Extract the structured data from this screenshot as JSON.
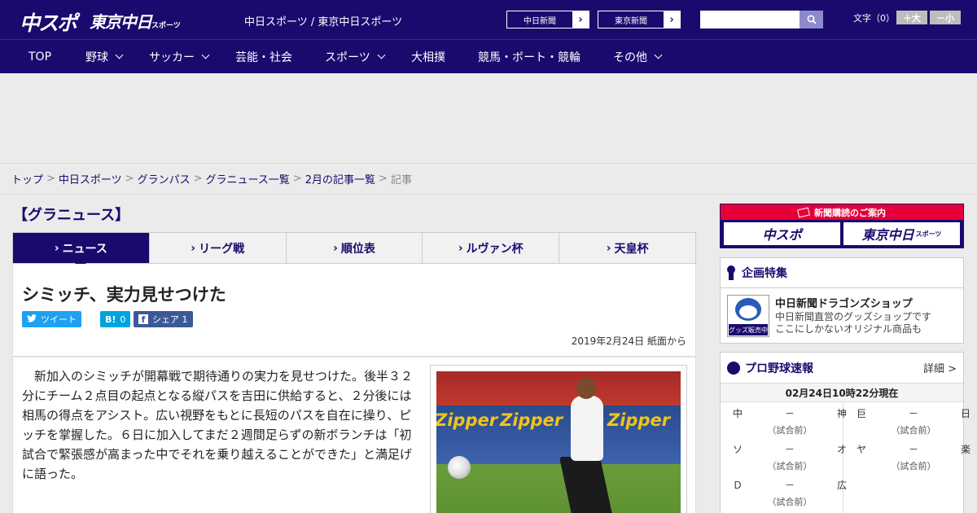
{
  "header": {
    "logo_main": "中スポ",
    "logo_tokyo": "東京中日",
    "logo_tokyo_small": "スポーツ",
    "site_title": "中日スポーツ / 東京中日スポーツ",
    "paper_links": [
      {
        "label": "中日新聞",
        "arrow": "›"
      },
      {
        "label": "東京新聞",
        "arrow": "›"
      }
    ],
    "search": {
      "placeholder": "",
      "value": ""
    },
    "font_size_label": "文字（0）",
    "font_larger": "＋大",
    "font_smaller": "－小"
  },
  "nav": {
    "items": [
      {
        "label": "TOP",
        "dropdown": false
      },
      {
        "label": "野球",
        "dropdown": true
      },
      {
        "label": "サッカー",
        "dropdown": true
      },
      {
        "label": "芸能・社会",
        "dropdown": false
      },
      {
        "label": "スポーツ",
        "dropdown": true
      },
      {
        "label": "大相撲",
        "dropdown": false
      },
      {
        "label": "競馬・ボート・競輪",
        "dropdown": false
      },
      {
        "label": "その他",
        "dropdown": true
      }
    ]
  },
  "breadcrumb": {
    "items": [
      "トップ",
      "中日スポーツ",
      "グランパス",
      "グラニュース一覧",
      "2月の記事一覧"
    ],
    "current": "記事",
    "separator": ">"
  },
  "section": {
    "title": "【グラニュース】"
  },
  "tabs": [
    {
      "label": "ニュース",
      "active": true
    },
    {
      "label": "リーグ戦",
      "active": false
    },
    {
      "label": "順位表",
      "active": false
    },
    {
      "label": "ルヴァン杯",
      "active": false
    },
    {
      "label": "天皇杯",
      "active": false
    }
  ],
  "article": {
    "headline": "シミッチ、実力見せつけた",
    "share": {
      "tweet_label": "ツイート",
      "hatena_icon": "B!",
      "hatena_count": "0",
      "facebook_label": "シェア",
      "facebook_count": "1"
    },
    "date": "2019年2月24日 紙面から",
    "body": "新加入のシミッチが開幕戦で期待通りの実力を見せつけた。後半３２分にチーム２点目の起点となる縦パスを吉田に供給すると、２分後には相馬の得点をアシスト。広い視野をもとに長短のパスを自在に操り、ピッチを掌握した。６日に加入してまだ２週間足らずの新ボランチは「初試合で緊張感が高まった中でそれを乗り越えることができた」と満足げに語った。",
    "photo_ad_text": "Zipper"
  },
  "sidebar": {
    "subscribe": {
      "title": "新聞購読のご案内",
      "logo_left": "中スポ",
      "logo_right": "東京中日",
      "logo_right_small": "スポーツ"
    },
    "feature": {
      "heading": "企画特集",
      "thumb_label": "グッズ販売中",
      "title": "中日新聞ドラゴンズショップ",
      "desc_line1": "中日新聞直営のグッズショップです",
      "desc_line2": "ここにしかないオリジナル商品も"
    },
    "scores": {
      "heading": "プロ野球速報",
      "more": "詳細 >",
      "updated": "02月24日10時22分現在",
      "games": [
        {
          "home": "中",
          "dash": "－",
          "away": "神",
          "status": "（試合前）"
        },
        {
          "home": "巨",
          "dash": "－",
          "away": "日",
          "status": "（試合前）"
        },
        {
          "home": "ソ",
          "dash": "－",
          "away": "オ",
          "status": "（試合前）"
        },
        {
          "home": "ヤ",
          "dash": "－",
          "away": "楽",
          "status": "（試合前）"
        },
        {
          "home": "Ｄ",
          "dash": "－",
          "away": "広",
          "status": "（試合前）"
        }
      ]
    }
  },
  "colors": {
    "brand_navy": "#1a0a6e",
    "subscribe_red": "#e6003a",
    "twitter": "#1da1f2",
    "hatena": "#00a4de",
    "facebook": "#3b5998"
  }
}
